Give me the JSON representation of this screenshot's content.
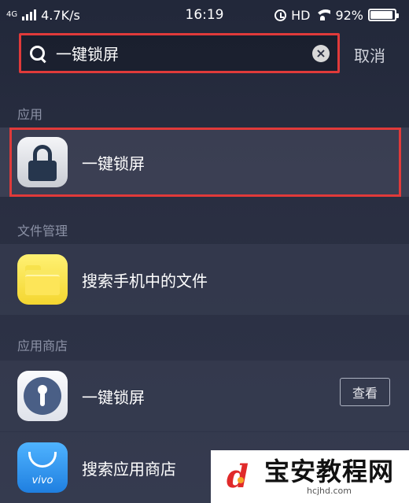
{
  "status_bar": {
    "network_type": "4G",
    "speed": "4.7K/s",
    "time": "16:19",
    "hd_label": "HD",
    "battery": "92%",
    "battery_level": 0.92
  },
  "search": {
    "query": "一键锁屏",
    "cancel_label": "取消"
  },
  "sections": {
    "apps": {
      "header": "应用",
      "items": [
        {
          "label": "一键锁屏",
          "icon": "lock-icon"
        }
      ]
    },
    "files": {
      "header": "文件管理",
      "items": [
        {
          "label": "搜索手机中的文件",
          "icon": "folder-icon"
        }
      ]
    },
    "store": {
      "header": "应用商店",
      "items": [
        {
          "label": "一键锁屏",
          "icon": "keyhole-icon",
          "action_label": "查看"
        },
        {
          "label": "搜索应用商店",
          "icon": "vivo-store-icon",
          "icon_text": "vivo"
        }
      ]
    }
  },
  "watermark": {
    "title": "宝安教程网",
    "url": "hcjhd.com"
  },
  "colors": {
    "highlight_border": "#e03a3a",
    "background": "#2a2f42",
    "section_header": "#8c92a6"
  }
}
